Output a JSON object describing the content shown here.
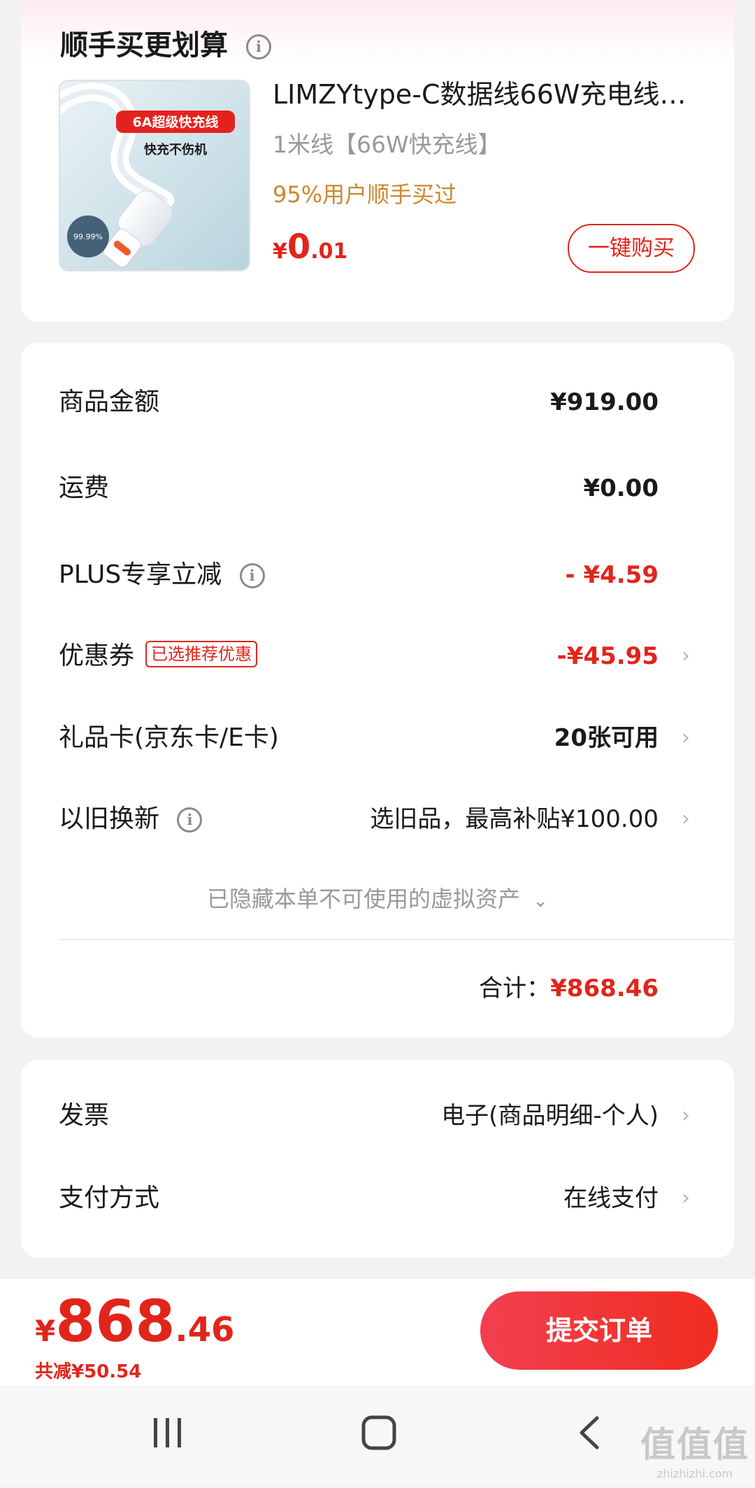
{
  "recommend": {
    "title": "顺手买更划算",
    "product_title": "LIMZYtype-C数据线66W充电线…",
    "spec": "1米线【66W快充线】",
    "hint": "95%用户顺手买过",
    "price_symbol": "¥",
    "price_int": "0",
    "price_dec": ".01",
    "buy_label": "一键购买",
    "image_text": {
      "badge": "6A超级快充线",
      "sub": "快充不伤机",
      "percent": "99.99%"
    }
  },
  "cost": {
    "goods_label": "商品金额",
    "goods_value": "¥919.00",
    "shipping_label": "运费",
    "shipping_value": "¥0.00",
    "plus_label": "PLUS专享立减",
    "plus_value": "- ¥4.59",
    "coupon_label": "优惠券",
    "coupon_badge": "已选推荐优惠",
    "coupon_value": "-¥45.95",
    "giftcard_label": "礼品卡(京东卡/E卡)",
    "giftcard_value": "20张可用",
    "tradein_label": "以旧换新",
    "tradein_value": "选旧品，最高补贴¥100.00",
    "hidden_assets": "已隐藏本单不可使用的虚拟资产",
    "total_label": "合计：",
    "total_value": "¥868.46"
  },
  "invoice": {
    "invoice_label": "发票",
    "invoice_value": "电子(商品明细-个人)",
    "payment_label": "支付方式",
    "payment_value": "在线支付"
  },
  "bottom": {
    "price_symbol": "¥",
    "price_int": "868",
    "price_dec": ".46",
    "saved": "共减¥50.54",
    "submit_label": "提交订单"
  },
  "watermark": {
    "main": "值值值",
    "sub": "zhizhizhi.com"
  },
  "colors": {
    "accent": "#e1251b",
    "hint": "#c9892e"
  },
  "icons": [
    "info-icon",
    "chevron-right-icon",
    "chevron-down-icon",
    "recent-apps-icon",
    "home-icon",
    "back-icon"
  ]
}
